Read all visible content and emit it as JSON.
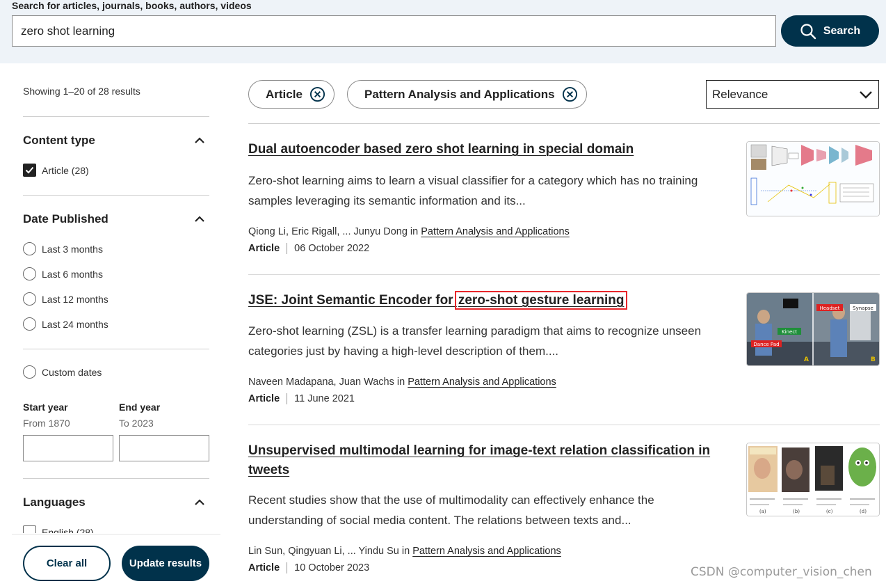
{
  "search": {
    "label": "Search for articles, journals, books, authors, videos",
    "query": "zero shot learning",
    "button_label": "Search"
  },
  "sidebar": {
    "showing": "Showing 1–20 of 28 results",
    "content_type": {
      "title": "Content type",
      "options": [
        {
          "label": "Article (28)",
          "checked": true
        }
      ]
    },
    "date_published": {
      "title": "Date Published",
      "options": [
        "Last 3 months",
        "Last 6 months",
        "Last 12 months",
        "Last 24 months"
      ],
      "custom_label": "Custom dates",
      "start_year_label": "Start year",
      "start_year_hint": "From 1870",
      "end_year_label": "End year",
      "end_year_hint": "To 2023"
    },
    "languages": {
      "title": "Languages",
      "options": [
        {
          "label": "English (28)",
          "checked": false
        }
      ]
    },
    "clear_label": "Clear all",
    "update_label": "Update results"
  },
  "filters": {
    "chips": [
      "Article",
      "Pattern Analysis and Applications"
    ],
    "sort": "Relevance"
  },
  "results": [
    {
      "title": "Dual autoencoder based zero shot learning in special domain",
      "snippet": "Zero-shot learning aims to learn a visual classifier for a category which has no training samples leveraging its semantic information and its...",
      "authors": "Qiong Li, Eric Rigall, ... Junyu Dong in",
      "journal": "Pattern Analysis and Applications",
      "type": "Article",
      "date": "06 October 2022"
    },
    {
      "title_prefix": "JSE: Joint Semantic Encoder for ",
      "title_highlight": "zero-shot gesture learning",
      "snippet": "Zero-shot learning (ZSL) is a transfer learning paradigm that aims to recognize unseen categories just by having a high-level description of them....",
      "authors": "Naveen Madapana, Juan Wachs in",
      "journal": "Pattern Analysis and Applications",
      "type": "Article",
      "date": "11 June 2021",
      "thumb_labels": [
        "Headset",
        "Synapse",
        "Kinect",
        "Dance Pad",
        "A",
        "B"
      ]
    },
    {
      "title": "Unsupervised multimodal learning for image-text relation classification in tweets",
      "snippet": "Recent studies show that the use of multimodality can effectively enhance the understanding of social media content. The relations between texts and...",
      "authors": "Lin Sun, Qingyuan Li, ... Yindu Su in",
      "journal": "Pattern Analysis and Applications",
      "type": "Article",
      "date": "10 October 2023",
      "thumb_labels": [
        "(a)",
        "(b)",
        "(c)",
        "(d)"
      ]
    }
  ],
  "watermark": "CSDN @computer_vision_chen",
  "colors": {
    "primary": "#01324b",
    "search_band": "#eef3f8",
    "highlight_box": "#e8262a"
  }
}
